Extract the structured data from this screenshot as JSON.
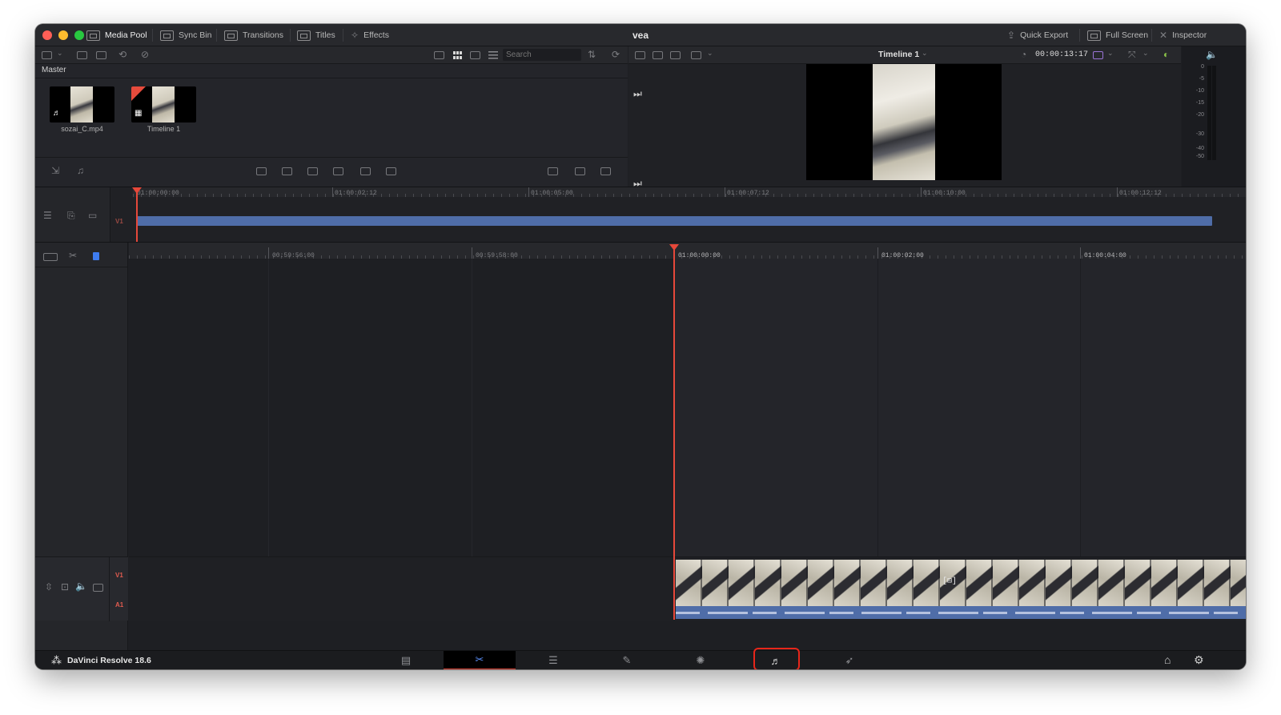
{
  "window": {
    "project_title": "vea",
    "title_bar": {
      "left_buttons": [
        {
          "label": "Media Pool",
          "icon": "media-pool-icon",
          "active": true
        },
        {
          "label": "Sync Bin",
          "icon": "sync-bin-icon"
        },
        {
          "label": "Transitions",
          "icon": "transitions-icon"
        },
        {
          "label": "Titles",
          "icon": "titles-icon"
        },
        {
          "label": "Effects",
          "icon": "effects-wand-icon"
        }
      ],
      "right_buttons": [
        {
          "label": "Quick Export",
          "icon": "export-icon"
        },
        {
          "label": "Full Screen",
          "icon": "full-screen-icon"
        },
        {
          "label": "Inspector",
          "icon": "inspector-icon"
        }
      ]
    }
  },
  "media_pool": {
    "search_placeholder": "Search",
    "bin_name": "Master",
    "clips": [
      {
        "name": "sozai_C.mp4",
        "badge": "♬",
        "type": "audio-video"
      },
      {
        "name": "Timeline 1",
        "badge": "▦",
        "type": "timeline"
      }
    ]
  },
  "viewer": {
    "timeline_name": "Timeline 1",
    "timecode": "00:00:13:17"
  },
  "audio_meter": {
    "scale": [
      "0",
      "-5",
      "-10",
      "-15",
      "-20",
      "-30",
      "-40",
      "-50"
    ]
  },
  "upper_timeline": {
    "track": "V1",
    "ticks": [
      "01:00:00:00",
      "01:00:02:12",
      "01:00:05:00",
      "01:00:07:12",
      "01:00:10:00",
      "01:00:12:12"
    ]
  },
  "lower_timeline": {
    "ticks": [
      "00:59:56:00",
      "00:59:58:00",
      "01:00:00:00",
      "01:00:02:00",
      "01:00:04:00"
    ],
    "tracks": [
      "V1",
      "A1"
    ]
  },
  "bottom_bar": {
    "app_name": "DaVinci Resolve 18.6",
    "pages": [
      {
        "name": "media",
        "icon": "media-page-icon",
        "glyph": "▤"
      },
      {
        "name": "cut",
        "icon": "cut-page-icon",
        "glyph": "✂",
        "active": true
      },
      {
        "name": "edit",
        "icon": "edit-page-icon",
        "glyph": "☰"
      },
      {
        "name": "fusion",
        "icon": "fusion-page-icon",
        "glyph": "✎"
      },
      {
        "name": "color",
        "icon": "color-page-icon",
        "glyph": "✺"
      },
      {
        "name": "fairlight",
        "icon": "fairlight-music-note-icon",
        "glyph": "♬",
        "highlighted": true
      },
      {
        "name": "deliver",
        "icon": "deliver-rocket-icon",
        "glyph": "➶"
      }
    ],
    "right_icons": [
      {
        "name": "home",
        "glyph": "⌂"
      },
      {
        "name": "settings",
        "glyph": "⚙"
      }
    ],
    "highlight_color": "#e8261a"
  },
  "colors": {
    "playhead": "#e6483a",
    "audio_clip": "#4f6da8",
    "accent_blue": "#5a8ef7"
  }
}
